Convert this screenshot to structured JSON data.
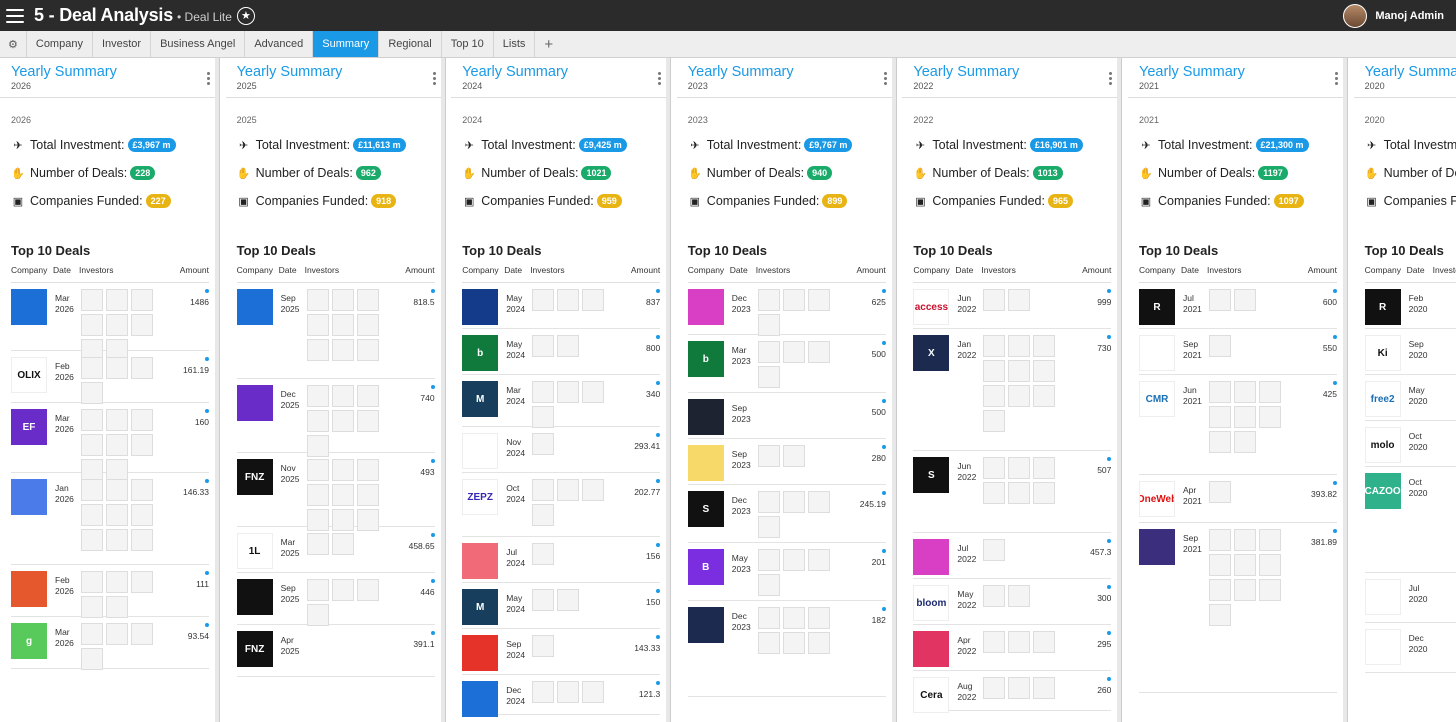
{
  "app": {
    "title": "5 - Deal Analysis",
    "subtitle": "• Deal Lite",
    "user": "Manoj Admin"
  },
  "tabs": [
    "Company",
    "Investor",
    "Business Angel",
    "Advanced",
    "Summary",
    "Regional",
    "Top 10",
    "Lists"
  ],
  "active_tab": "Summary",
  "labels": {
    "panel_title": "Yearly Summary",
    "total_investment": "Total Investment:",
    "number_of_deals": "Number of Deals:",
    "companies_funded": "Companies Funded:",
    "top10": "Top 10 Deals",
    "th_company": "Company",
    "th_date": "Date",
    "th_investors": "Investors",
    "th_amount": "Amount"
  },
  "columns": [
    {
      "year": "2026",
      "investment": "£3,967 m",
      "deals": "228",
      "companies": "227",
      "rows": [
        {
          "logo": "",
          "date": "Mar 2026",
          "amount": "1486",
          "inv": 8,
          "color": "#1c6fd6",
          "h": 68
        },
        {
          "logo": "OLIX",
          "date": "Feb 2026",
          "amount": "161.19",
          "inv": 4,
          "color": "#ffffff",
          "text": "#111",
          "h": 52
        },
        {
          "logo": "EF",
          "date": "Mar 2026",
          "amount": "160",
          "inv": 8,
          "color": "#6a2cc9",
          "h": 70
        },
        {
          "logo": "",
          "date": "Jan 2026",
          "amount": "146.33",
          "inv": 9,
          "color": "#4a7be8",
          "h": 92
        },
        {
          "logo": "",
          "date": "Feb 2026",
          "amount": "111",
          "inv": 5,
          "color": "#e5572c",
          "h": 52
        },
        {
          "logo": "g",
          "date": "Mar 2026",
          "amount": "93.54",
          "inv": 4,
          "color": "#58c95b",
          "h": 52
        }
      ]
    },
    {
      "year": "2025",
      "investment": "£11,613 m",
      "deals": "962",
      "companies": "918",
      "rows": [
        {
          "logo": "",
          "date": "Sep 2025",
          "amount": "818.5",
          "inv": 9,
          "color": "#1c6fd6",
          "h": 96
        },
        {
          "logo": "",
          "date": "Dec 2025",
          "amount": "740",
          "inv": 7,
          "color": "#6a2cc9",
          "h": 74
        },
        {
          "logo": "FNZ",
          "date": "Nov 2025",
          "amount": "493",
          "inv": 9,
          "color": "#111111",
          "h": 74
        },
        {
          "logo": "1L",
          "date": "Mar 2025",
          "amount": "458.65",
          "inv": 2,
          "color": "#ffffff",
          "text": "#111",
          "h": 46
        },
        {
          "logo": "",
          "date": "Sep 2025",
          "amount": "446",
          "inv": 4,
          "color": "#111111",
          "h": 52
        },
        {
          "logo": "FNZ",
          "date": "Apr 2025",
          "amount": "391.1",
          "inv": 0,
          "color": "#111111",
          "h": 52
        }
      ]
    },
    {
      "year": "2024",
      "investment": "£9,425 m",
      "deals": "1021",
      "companies": "959",
      "rows": [
        {
          "logo": "",
          "date": "May 2024",
          "amount": "837",
          "inv": 3,
          "color": "#143a8a",
          "h": 46
        },
        {
          "logo": "b",
          "date": "May 2024",
          "amount": "800",
          "inv": 2,
          "color": "#0f7a3c",
          "h": 46
        },
        {
          "logo": "M",
          "date": "Mar 2024",
          "amount": "340",
          "inv": 4,
          "color": "#173e5c",
          "h": 52
        },
        {
          "logo": "",
          "date": "Nov 2024",
          "amount": "293.41",
          "inv": 1,
          "color": "#ffffff",
          "text": "#e8731c",
          "h": 46
        },
        {
          "logo": "ZEPZ",
          "date": "Oct 2024",
          "amount": "202.77",
          "inv": 4,
          "color": "#ffffff",
          "text": "#3528b5",
          "h": 64
        },
        {
          "logo": "",
          "date": "Jul 2024",
          "amount": "156",
          "inv": 1,
          "color": "#f06a78",
          "h": 46
        },
        {
          "logo": "M",
          "date": "May 2024",
          "amount": "150",
          "inv": 2,
          "color": "#173e5c",
          "h": 46
        },
        {
          "logo": "",
          "date": "Sep 2024",
          "amount": "143.33",
          "inv": 1,
          "color": "#e6332a",
          "h": 46
        },
        {
          "logo": "",
          "date": "Dec 2024",
          "amount": "121.3",
          "inv": 3,
          "color": "#1c6fd6",
          "h": 40
        }
      ]
    },
    {
      "year": "2023",
      "investment": "£9,767 m",
      "deals": "940",
      "companies": "899",
      "rows": [
        {
          "logo": "",
          "date": "Dec 2023",
          "amount": "625",
          "inv": 4,
          "color": "#d93fc5",
          "h": 52
        },
        {
          "logo": "b",
          "date": "Mar 2023",
          "amount": "500",
          "inv": 4,
          "color": "#0f7a3c",
          "h": 58
        },
        {
          "logo": "",
          "date": "Sep 2023",
          "amount": "500",
          "inv": 0,
          "color": "#1d2330",
          "h": 46
        },
        {
          "logo": "",
          "date": "Sep 2023",
          "amount": "280",
          "inv": 2,
          "color": "#f7d96a",
          "h": 46
        },
        {
          "logo": "S",
          "date": "Dec 2023",
          "amount": "245.19",
          "inv": 4,
          "color": "#111111",
          "h": 58
        },
        {
          "logo": "B",
          "date": "May 2023",
          "amount": "201",
          "inv": 4,
          "color": "#7b2ee0",
          "h": 58
        },
        {
          "logo": "",
          "date": "Dec 2023",
          "amount": "182",
          "inv": 6,
          "color": "#1d2a4f",
          "h": 96
        }
      ]
    },
    {
      "year": "2022",
      "investment": "£16,901 m",
      "deals": "1013",
      "companies": "965",
      "rows": [
        {
          "logo": "access",
          "date": "Jun 2022",
          "amount": "999",
          "inv": 2,
          "color": "#ffffff",
          "text": "#c8102e",
          "h": 46
        },
        {
          "logo": "X",
          "date": "Jan 2022",
          "amount": "730",
          "inv": 10,
          "color": "#1d2a4f",
          "h": 122
        },
        {
          "logo": "S",
          "date": "Jun 2022",
          "amount": "507",
          "inv": 6,
          "color": "#111111",
          "h": 82
        },
        {
          "logo": "",
          "date": "Jul 2022",
          "amount": "457.3",
          "inv": 1,
          "color": "#d93fc5",
          "h": 46
        },
        {
          "logo": "bloom",
          "date": "May 2022",
          "amount": "300",
          "inv": 2,
          "color": "#ffffff",
          "text": "#1d2a6f",
          "h": 46
        },
        {
          "logo": "",
          "date": "Apr 2022",
          "amount": "295",
          "inv": 3,
          "color": "#e23463",
          "h": 46
        },
        {
          "logo": "Cera",
          "date": "Aug 2022",
          "amount": "260",
          "inv": 3,
          "color": "#ffffff",
          "text": "#111",
          "h": 40
        }
      ]
    },
    {
      "year": "2021",
      "investment": "£21,300 m",
      "deals": "1197",
      "companies": "1097",
      "rows": [
        {
          "logo": "R",
          "date": "Jul 2021",
          "amount": "600",
          "inv": 2,
          "color": "#111111",
          "h": 46
        },
        {
          "logo": "",
          "date": "Sep 2021",
          "amount": "550",
          "inv": 1,
          "color": "#ffffff",
          "text": "#4aa0d6",
          "h": 46
        },
        {
          "logo": "CMR",
          "date": "Jun 2021",
          "amount": "425",
          "inv": 8,
          "color": "#ffffff",
          "text": "#1a6fb5",
          "h": 100
        },
        {
          "logo": "OneWeb",
          "date": "Apr 2021",
          "amount": "393.82",
          "inv": 1,
          "color": "#ffffff",
          "text": "#d11",
          "h": 48
        },
        {
          "logo": "",
          "date": "Sep 2021",
          "amount": "381.89",
          "inv": 10,
          "color": "#3a2e7d",
          "h": 170
        }
      ]
    },
    {
      "year": "2020",
      "investment": "",
      "deals": "",
      "companies": "",
      "rows": [
        {
          "logo": "R",
          "date": "Feb 2020",
          "amount": "",
          "inv": 0,
          "color": "#111111",
          "h": 46
        },
        {
          "logo": "Ki",
          "date": "Sep 2020",
          "amount": "",
          "inv": 0,
          "color": "#ffffff",
          "text": "#111",
          "h": 46
        },
        {
          "logo": "free2",
          "date": "May 2020",
          "amount": "",
          "inv": 0,
          "color": "#ffffff",
          "text": "#1a6fb5",
          "h": 46
        },
        {
          "logo": "molo",
          "date": "Oct 2020",
          "amount": "",
          "inv": 0,
          "color": "#ffffff",
          "text": "#111",
          "h": 46
        },
        {
          "logo": "CAZOO",
          "date": "Oct 2020",
          "amount": "",
          "inv": 0,
          "color": "#2fb28b",
          "h": 106
        },
        {
          "logo": "",
          "date": "Jul 2020",
          "amount": "",
          "inv": 0,
          "color": "#ffffff",
          "text": "#e8601c",
          "h": 50
        },
        {
          "logo": "",
          "date": "Dec 2020",
          "amount": "",
          "inv": 0,
          "color": "#ffffff",
          "text": "#e84a5f",
          "h": 50
        }
      ]
    }
  ]
}
